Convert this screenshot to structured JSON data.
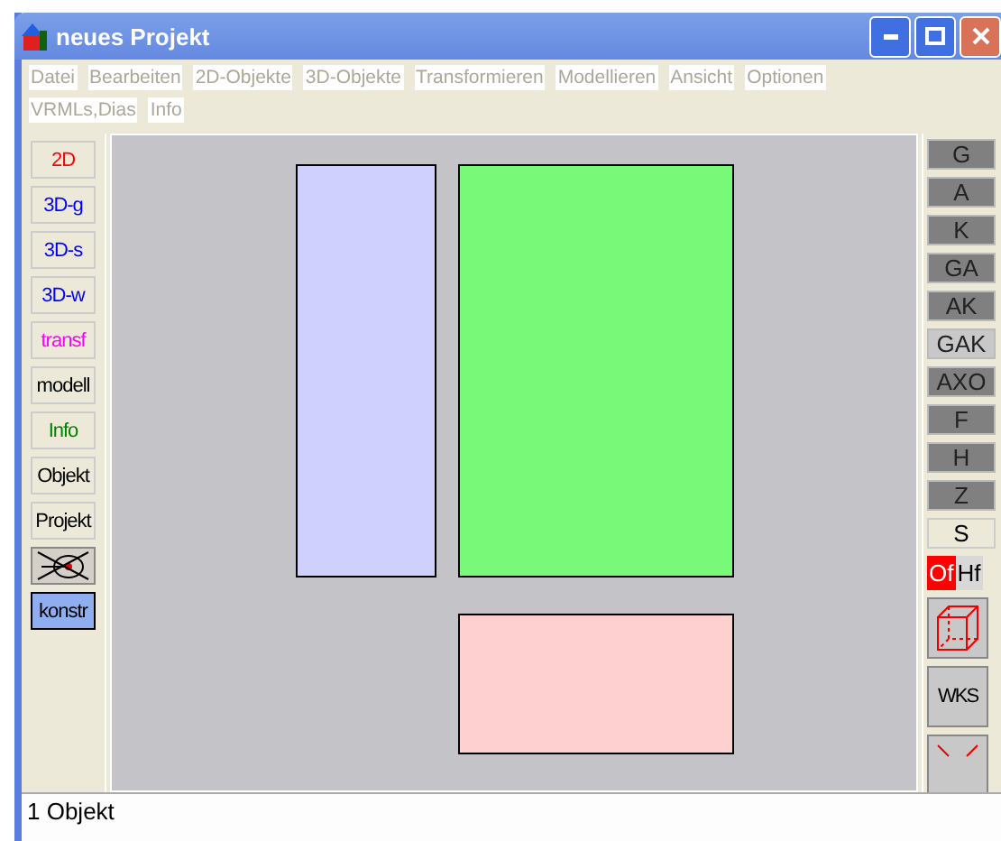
{
  "window": {
    "title": "neues Projekt"
  },
  "menu": [
    {
      "label": "Datei",
      "disabled": true
    },
    {
      "label": "Bearbeiten",
      "disabled": true
    },
    {
      "label": "2D-Objekte",
      "disabled": true
    },
    {
      "label": "3D-Objekte",
      "disabled": true
    },
    {
      "label": "Transformieren",
      "disabled": true
    },
    {
      "label": "Modellieren",
      "disabled": true
    },
    {
      "label": "Ansicht",
      "disabled": true
    },
    {
      "label": "Optionen",
      "disabled": true
    },
    {
      "label": "VRMLs,Dias",
      "disabled": true
    },
    {
      "label": "Info",
      "disabled": true
    }
  ],
  "left_toolbar": [
    {
      "kind": "text",
      "label": "2D",
      "color": "#ff0000",
      "selected": false
    },
    {
      "kind": "text",
      "label": "3D-g",
      "color": "#0000ff",
      "selected": false
    },
    {
      "kind": "text",
      "label": "3D-s",
      "color": "#0000ff",
      "selected": false
    },
    {
      "kind": "text",
      "label": "3D-w",
      "color": "#0000ff",
      "selected": false
    },
    {
      "kind": "text",
      "label": "transf",
      "color": "#ff00ff",
      "selected": false
    },
    {
      "kind": "text",
      "label": "modell",
      "color": "#000000",
      "selected": false
    },
    {
      "kind": "text",
      "label": "Info",
      "color": "#008000",
      "selected": false
    },
    {
      "kind": "text",
      "label": "Objekt",
      "color": "#000000",
      "selected": false
    },
    {
      "kind": "text",
      "label": "Projekt",
      "color": "#000000",
      "selected": false
    },
    {
      "kind": "icon",
      "selected": false
    },
    {
      "kind": "text",
      "label": "konstr",
      "color": "#000000",
      "selected": true
    }
  ],
  "canvas": {
    "shapes": [
      {
        "color": "#d0d0ff"
      },
      {
        "color": "#78fa78"
      },
      {
        "color": "#ffd0d0"
      }
    ]
  },
  "right_toolbar": [
    {
      "kind": "mode",
      "label": "G",
      "selected": false
    },
    {
      "kind": "mode",
      "label": "A",
      "selected": false
    },
    {
      "kind": "mode",
      "label": "K",
      "selected": false
    },
    {
      "kind": "mode",
      "label": "GA",
      "selected": false
    },
    {
      "kind": "mode",
      "label": "AK",
      "selected": false
    },
    {
      "kind": "mode",
      "label": "GAK",
      "selected": true
    },
    {
      "kind": "mode",
      "label": "AXO",
      "selected": false
    },
    {
      "kind": "mode",
      "label": "F",
      "selected": false
    },
    {
      "kind": "mode",
      "label": "H",
      "selected": false
    },
    {
      "kind": "mode",
      "label": "Z",
      "selected": false
    },
    {
      "kind": "switch",
      "label": "S",
      "selected": false
    },
    {
      "kind": "pair",
      "options": [
        {
          "label": "Of",
          "selected": true
        },
        {
          "label": "Hf",
          "selected": false
        }
      ]
    },
    {
      "kind": "cube"
    },
    {
      "kind": "mode-big",
      "label": "WKS"
    },
    {
      "kind": "cut"
    }
  ],
  "status_bar": {
    "text": "1 Objekt"
  }
}
